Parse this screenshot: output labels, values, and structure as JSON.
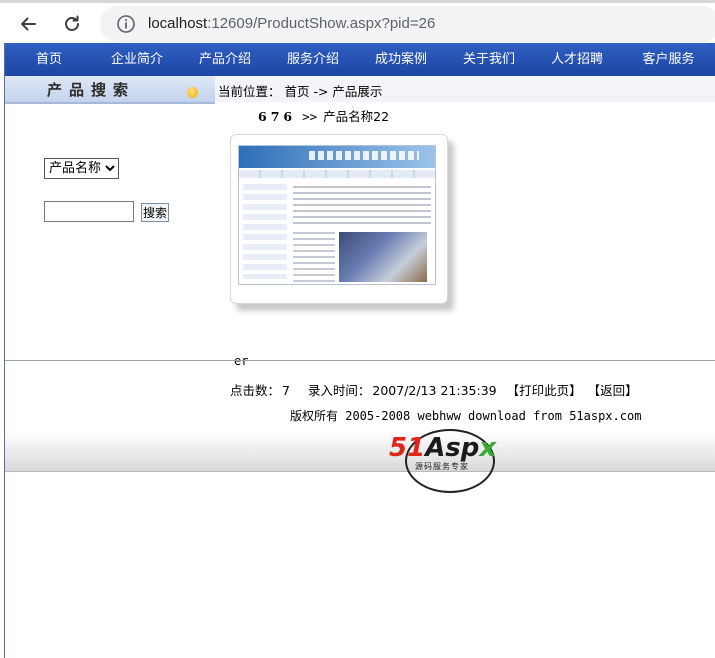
{
  "browser": {
    "url_host": "localhost",
    "url_rest": ":12609/ProductShow.aspx?pid=26"
  },
  "topnav": {
    "items": [
      "首页",
      "企业简介",
      "产品介绍",
      "服务介绍",
      "成功案例",
      "关于我们",
      "人才招聘",
      "客户服务"
    ]
  },
  "sidebar": {
    "title": "产品搜索",
    "select_value": "产品名称",
    "search_input_value": "",
    "search_button_label": "搜索"
  },
  "main": {
    "location_label": "当前位置：",
    "location_path": "首页 -> 产品展示",
    "product_id": "676",
    "product_sep": ">>",
    "product_name": "产品名称22",
    "description": "er",
    "clicks_label": "点击数：",
    "clicks_value": "7",
    "time_label": "录入时间：",
    "time_value": "2007/2/13 21:35:39",
    "print_link": "【打印此页】",
    "back_link": "【返回】"
  },
  "footer": {
    "copyright": "版权所有 2005-2008 webhww download from 51aspx.com",
    "logo_51": "51",
    "logo_asp": "Asp",
    "logo_x": "x",
    "logo_sub": "源码服务专家"
  },
  "colors": {
    "nav_blue": "#1d46a5",
    "logo_red": "#e0261b",
    "logo_green": "#3aaa35"
  }
}
